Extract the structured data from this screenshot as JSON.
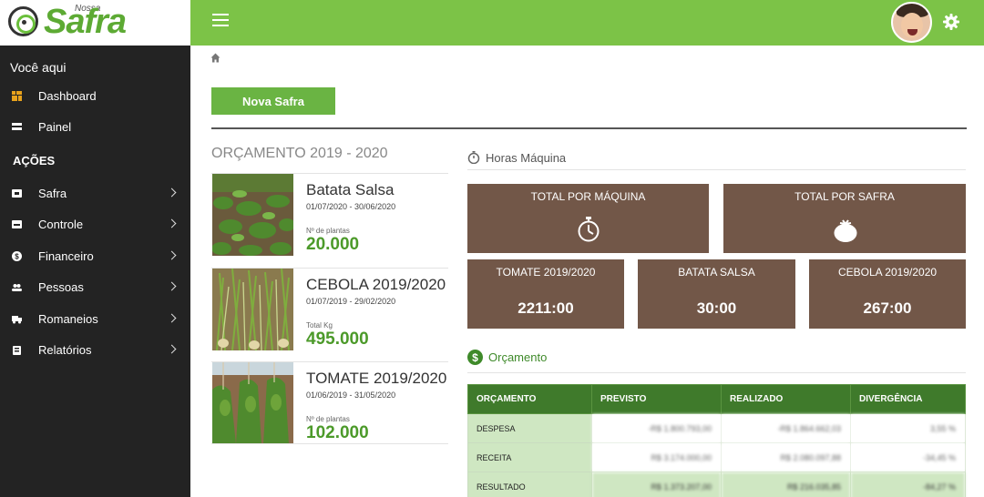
{
  "app": {
    "logo_small": "Nossa",
    "logo_main": "Safra"
  },
  "sidebar": {
    "voce_aqui": "Você aqui",
    "nav": [
      {
        "label": "Dashboard",
        "icon": "dashboard-icon"
      },
      {
        "label": "Painel",
        "icon": "panel-icon"
      }
    ],
    "acoes_title": "AÇÕES",
    "acoes": [
      {
        "label": "Safra",
        "icon": "safra-icon"
      },
      {
        "label": "Controle",
        "icon": "controle-icon"
      },
      {
        "label": "Financeiro",
        "icon": "dollar-icon"
      },
      {
        "label": "Pessoas",
        "icon": "people-icon"
      },
      {
        "label": "Romaneios",
        "icon": "truck-icon"
      },
      {
        "label": "Relatórios",
        "icon": "report-icon"
      }
    ]
  },
  "main": {
    "new_button": "Nova Safra",
    "orcamento_title": "ORÇAMENTO 2019 - 2020",
    "safras": [
      {
        "name": "Batata Salsa",
        "dates": "01/07/2020 - 30/06/2020",
        "metric_label": "Nº de plantas",
        "metric_value": "20.000"
      },
      {
        "name": "CEBOLA 2019/2020",
        "dates": "01/07/2019 - 29/02/2020",
        "metric_label": "Total Kg",
        "metric_value": "495.000"
      },
      {
        "name": "TOMATE 2019/2020",
        "dates": "01/06/2019 - 31/05/2020",
        "metric_label": "Nº de plantas",
        "metric_value": "102.000"
      }
    ],
    "horas": {
      "title": "Horas Máquina",
      "total_maquina": "TOTAL POR MÁQUINA",
      "total_safra": "TOTAL POR SAFRA",
      "tiles": [
        {
          "label": "TOMATE 2019/2020",
          "value": "2211:00"
        },
        {
          "label": "BATATA SALSA",
          "value": "30:00"
        },
        {
          "label": "CEBOLA 2019/2020",
          "value": "267:00"
        }
      ]
    },
    "orcamento": {
      "title": "Orçamento",
      "headers": [
        "ORÇAMENTO",
        "PREVISTO",
        "REALIZADO",
        "DIVERGÊNCIA"
      ],
      "rows": [
        {
          "label": "DESPESA",
          "previsto": "-R$ 1.800.793,00",
          "realizado": "-R$ 1.864.662,03",
          "divergencia": "3,55 %"
        },
        {
          "label": "RECEITA",
          "previsto": "R$ 3.174.000,00",
          "realizado": "R$ 2.080.097,88",
          "divergencia": "-34,45 %"
        },
        {
          "label": "RESULTADO",
          "previsto": "R$ 1.373.207,00",
          "realizado": "R$ 216.035,85",
          "divergencia": "-84,27 %"
        }
      ]
    }
  },
  "colors": {
    "topbar": "#7cc347",
    "sidebar": "#232323",
    "tile": "#725748",
    "table_header": "#3f7a2b",
    "accent_green": "#4c9a2a"
  }
}
